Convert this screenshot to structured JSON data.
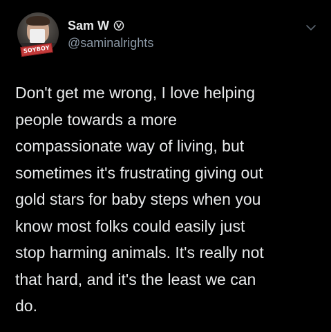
{
  "tweet": {
    "author": {
      "display_name": "Sam W",
      "handle": "@saminalrights",
      "avatar_badge_text": "SOYBOY",
      "verified_icon": "circle-v-icon"
    },
    "menu_icon": "chevron-down-icon",
    "text": "Don't get me wrong, I love helping\npeople towards a more\ncompassionate way of living, but\nsometimes it's frustrating giving out\ngold stars for baby steps when you\nknow most folks could easily just\nstop harming animals. It's really not\nthat hard, and it's the least we can\ndo."
  },
  "colors": {
    "background": "#000000",
    "text_primary": "#e7e9ea",
    "text_secondary": "#8b98a5"
  }
}
